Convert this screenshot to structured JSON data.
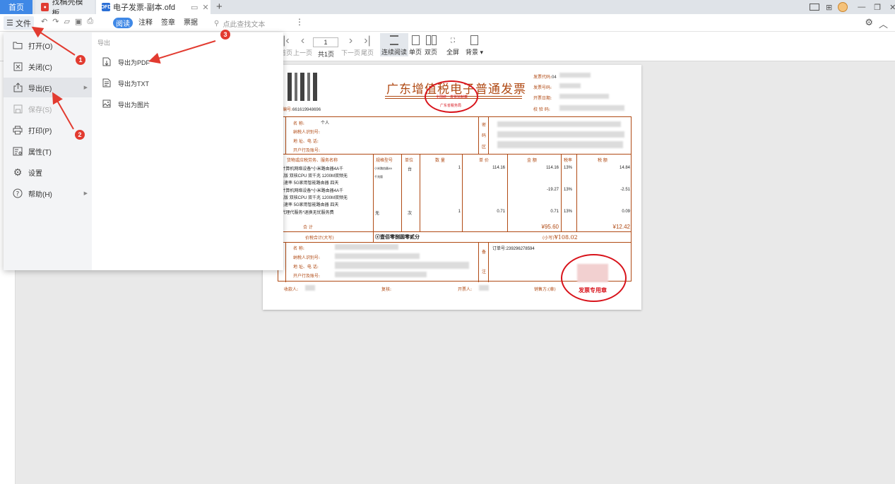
{
  "tabs": {
    "home": "首页",
    "template": "找稿壳模板",
    "doc": "电子发票-副本.ofd",
    "doc_icon": "OFD"
  },
  "toolbar": {
    "file_label": "文件",
    "modes": [
      "阅读",
      "注释",
      "签章",
      "票据"
    ],
    "search_placeholder": "点此查找文本"
  },
  "subbar": {
    "first_label": "首页",
    "prev_label": "上一页",
    "page_value": "1",
    "total_label": "共1页",
    "next_label": "下一页",
    "last_label": "尾页",
    "continuous_label": "连续阅读",
    "single_label": "单页",
    "double_label": "双页",
    "fullscreen_label": "全屏",
    "background_label": "背景"
  },
  "menu": {
    "items": [
      {
        "label": "打开(O)",
        "icon": "folder-open-icon"
      },
      {
        "label": "关闭(C)",
        "icon": "close-box-icon"
      },
      {
        "label": "导出(E)",
        "icon": "export-icon"
      },
      {
        "label": "保存(S)",
        "icon": "save-icon"
      },
      {
        "label": "打印(P)",
        "icon": "print-icon"
      },
      {
        "label": "属性(T)",
        "icon": "properties-icon"
      },
      {
        "label": "设置",
        "icon": "gear-icon"
      },
      {
        "label": "帮助(H)",
        "icon": "help-icon"
      }
    ],
    "submenu_title": "导出",
    "submenu": [
      {
        "label": "导出为PDF",
        "icon": "pdf-export-icon"
      },
      {
        "label": "导出为TXT",
        "icon": "txt-export-icon"
      },
      {
        "label": "导出为图片",
        "icon": "image-export-icon"
      }
    ]
  },
  "annotations": [
    "1",
    "2",
    "3"
  ],
  "invoice": {
    "title": "广东增值税电子普通发票",
    "seal_top": "全国统一发票监制章",
    "seal_bottom": "广东省税务局",
    "code_label": "发票代码:",
    "code_value": "04",
    "number_label": "发票号码:",
    "date_label": "开票日期:",
    "check_label": "校 验 码:",
    "machine_label": "机器编号:",
    "machine_value": "661619948696",
    "buyer_name_label": "名      称:",
    "buyer_name_value": "个人",
    "buyer_tax_label": "纳税人识别号:",
    "buyer_addr_label": "地 址、电 话:",
    "buyer_bank_label": "开户行及账号:",
    "cipher_label": [
      "密",
      "码",
      "区"
    ],
    "headers": [
      "货物或应税劳务、服务名称",
      "规格型号",
      "单位",
      "数 量",
      "单 价",
      "金 额",
      "税率",
      "税 额"
    ],
    "rows": [
      {
        "name": [
          "*计算机网络设备*小米路由器4A千",
          "兆版 双核CPU 双千兆 1200M双频无",
          "线速率 5G家用智能路由器 四天"
        ],
        "spec": [
          "小米路由器4A",
          "千兆版"
        ],
        "unit": "台",
        "qty": "1",
        "price": "114.16",
        "amount": "114.16",
        "rate": "13%",
        "tax": "14.84"
      },
      {
        "name": [
          "*计算机网络设备*小米路由器4A千",
          "兆版 双核CPU 双千兆 1200M双频无",
          "线速率 5G家用智能路由器 四天"
        ],
        "spec": [],
        "unit": "",
        "qty": "",
        "price": "",
        "amount": "-19.27",
        "rate": "13%",
        "tax": "-2.51"
      },
      {
        "name": [
          "*代理代服务*退换无忧服务费"
        ],
        "spec": [
          "无"
        ],
        "unit": "次",
        "qty": "1",
        "price": "0.71",
        "amount": "0.71",
        "rate": "13%",
        "tax": "0.09"
      }
    ],
    "total_label": "合      计",
    "total_amount": "¥95.60",
    "total_tax": "¥12.42",
    "total_words_label": "价税合计(大写)",
    "total_words_value": "ⓧ壹佰零捌圆零贰分",
    "total_small_label": "(小写)",
    "total_small_value": "¥108.02",
    "seller_name_label": "名      称:",
    "seller_tax_label": "纳税人识别号:",
    "seller_addr_label": "地 址、电 话:",
    "seller_bank_label": "开户行及账号:",
    "remark_label": [
      "备",
      "注"
    ],
    "remark_value": "订单号:239296278594",
    "payee_label": "收款人:",
    "reviewer_label": "复核:",
    "drawer_label": "开票人:",
    "seller_label": "销售方:(章)",
    "seal2_text": "发票专用章"
  }
}
